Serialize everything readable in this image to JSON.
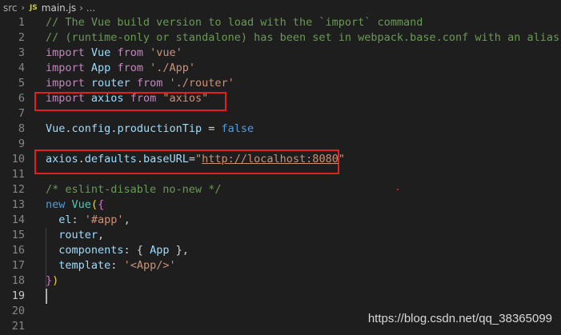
{
  "breadcrumb": {
    "folder": "src",
    "chevron": "›",
    "file_icon_text": "JS",
    "file": "main.js",
    "more": "›  ..."
  },
  "editor": {
    "lines": [
      {
        "n": "1",
        "tokens": [
          {
            "t": "// The Vue build version to load with the `import` command",
            "c": "com"
          }
        ]
      },
      {
        "n": "2",
        "tokens": [
          {
            "t": "// (runtime-only or standalone) has been set in webpack.base.conf with an alias.",
            "c": "com"
          }
        ]
      },
      {
        "n": "3",
        "tokens": [
          {
            "t": "import",
            "c": "kw"
          },
          {
            "t": " ",
            "c": ""
          },
          {
            "t": "Vue",
            "c": "var"
          },
          {
            "t": " ",
            "c": ""
          },
          {
            "t": "from",
            "c": "kw"
          },
          {
            "t": " ",
            "c": ""
          },
          {
            "t": "'vue'",
            "c": "str"
          }
        ]
      },
      {
        "n": "4",
        "tokens": [
          {
            "t": "import",
            "c": "kw"
          },
          {
            "t": " ",
            "c": ""
          },
          {
            "t": "App",
            "c": "var"
          },
          {
            "t": " ",
            "c": ""
          },
          {
            "t": "from",
            "c": "kw"
          },
          {
            "t": " ",
            "c": ""
          },
          {
            "t": "'./App'",
            "c": "str"
          }
        ]
      },
      {
        "n": "5",
        "tokens": [
          {
            "t": "import",
            "c": "kw"
          },
          {
            "t": " ",
            "c": ""
          },
          {
            "t": "router",
            "c": "var"
          },
          {
            "t": " ",
            "c": ""
          },
          {
            "t": "from",
            "c": "kw"
          },
          {
            "t": " ",
            "c": ""
          },
          {
            "t": "'./router'",
            "c": "str"
          }
        ]
      },
      {
        "n": "6",
        "tokens": [
          {
            "t": "import",
            "c": "kw"
          },
          {
            "t": " ",
            "c": ""
          },
          {
            "t": "axios",
            "c": "var"
          },
          {
            "t": " ",
            "c": ""
          },
          {
            "t": "from",
            "c": "kw"
          },
          {
            "t": " ",
            "c": ""
          },
          {
            "t": "\"axios\"",
            "c": "str"
          }
        ]
      },
      {
        "n": "7",
        "tokens": []
      },
      {
        "n": "8",
        "tokens": [
          {
            "t": "Vue",
            "c": "var"
          },
          {
            "t": ".",
            "c": ""
          },
          {
            "t": "config",
            "c": "var"
          },
          {
            "t": ".",
            "c": ""
          },
          {
            "t": "productionTip",
            "c": "var"
          },
          {
            "t": " = ",
            "c": ""
          },
          {
            "t": "false",
            "c": "kw2"
          }
        ]
      },
      {
        "n": "9",
        "tokens": []
      },
      {
        "n": "10",
        "tokens": [
          {
            "t": "axios",
            "c": "var"
          },
          {
            "t": ".",
            "c": ""
          },
          {
            "t": "defaults",
            "c": "var"
          },
          {
            "t": ".",
            "c": ""
          },
          {
            "t": "baseURL",
            "c": "var"
          },
          {
            "t": "=",
            "c": ""
          },
          {
            "t": "\"",
            "c": "str"
          },
          {
            "t": "http://localhost:8080",
            "c": "str url"
          },
          {
            "t": "\"",
            "c": "str"
          }
        ]
      },
      {
        "n": "11",
        "tokens": []
      },
      {
        "n": "12",
        "tokens": [
          {
            "t": "/* eslint-disable no-new */",
            "c": "com"
          }
        ]
      },
      {
        "n": "13",
        "tokens": [
          {
            "t": "new",
            "c": "kw2"
          },
          {
            "t": " ",
            "c": ""
          },
          {
            "t": "Vue",
            "c": "cls"
          },
          {
            "t": "(",
            "c": "br1"
          },
          {
            "t": "{",
            "c": "br2"
          }
        ]
      },
      {
        "n": "14",
        "tokens": [
          {
            "t": "  ",
            "c": ""
          },
          {
            "t": "el",
            "c": "var"
          },
          {
            "t": ": ",
            "c": ""
          },
          {
            "t": "'#app'",
            "c": "str"
          },
          {
            "t": ",",
            "c": ""
          }
        ]
      },
      {
        "n": "15",
        "tokens": [
          {
            "t": "  ",
            "c": ""
          },
          {
            "t": "router",
            "c": "var"
          },
          {
            "t": ",",
            "c": ""
          }
        ]
      },
      {
        "n": "16",
        "tokens": [
          {
            "t": "  ",
            "c": ""
          },
          {
            "t": "components",
            "c": "var"
          },
          {
            "t": ": { ",
            "c": ""
          },
          {
            "t": "App",
            "c": "var"
          },
          {
            "t": " },",
            "c": ""
          }
        ]
      },
      {
        "n": "17",
        "tokens": [
          {
            "t": "  ",
            "c": ""
          },
          {
            "t": "template",
            "c": "var"
          },
          {
            "t": ": ",
            "c": ""
          },
          {
            "t": "'<App/>'",
            "c": "str"
          }
        ]
      },
      {
        "n": "18",
        "tokens": [
          {
            "t": "}",
            "c": "br2"
          },
          {
            "t": ")",
            "c": "br1"
          }
        ]
      },
      {
        "n": "19",
        "tokens": []
      },
      {
        "n": "20",
        "tokens": []
      },
      {
        "n": "21",
        "tokens": []
      }
    ],
    "active_line": "19"
  },
  "watermark": "https://blog.csdn.net/qq_38365099",
  "colors": {
    "background": "#1e1e1e",
    "highlight_box": "#e0211f",
    "keyword": "#c586c0",
    "variable": "#9cdcfe",
    "string": "#ce9178",
    "comment": "#6a9955"
  }
}
